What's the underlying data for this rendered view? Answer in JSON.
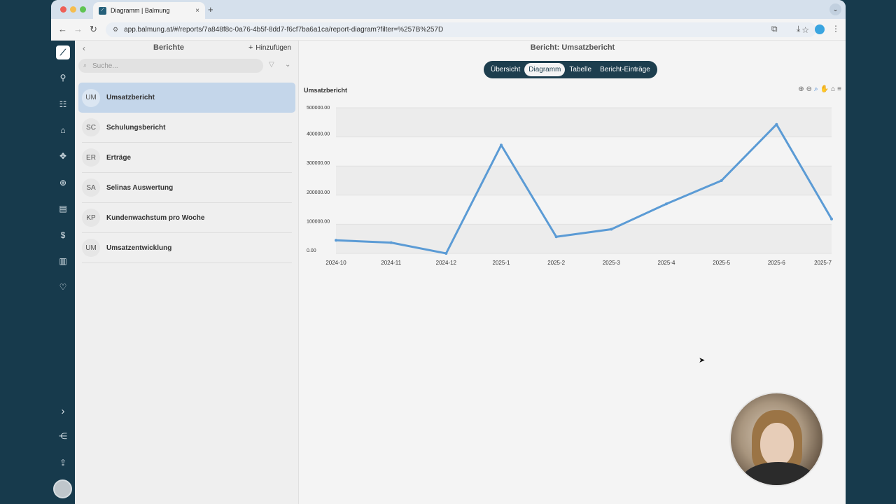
{
  "browser": {
    "tab_title": "Diagramm | Balmung",
    "tab_close": "×",
    "new_tab": "+",
    "url": "app.balmung.at/#/reports/7a848f8c-0a76-4b5f-8dd7-f6cf7ba6a1ca/report-diagram?filter=%257B%257D"
  },
  "panel": {
    "title": "Berichte",
    "add_label": "Hinzufügen",
    "search_placeholder": "Suche...",
    "reports": [
      {
        "abbr": "UM",
        "name": "Umsatzbericht"
      },
      {
        "abbr": "SC",
        "name": "Schulungsbericht"
      },
      {
        "abbr": "ER",
        "name": "Erträge"
      },
      {
        "abbr": "SA",
        "name": "Selinas Auswertung"
      },
      {
        "abbr": "KP",
        "name": "Kundenwachstum pro Woche"
      },
      {
        "abbr": "UM",
        "name": "Umsatzentwicklung"
      }
    ]
  },
  "main": {
    "title": "Bericht: Umsatzbericht",
    "tabs": [
      {
        "label": "Übersicht"
      },
      {
        "label": "Diagramm"
      },
      {
        "label": "Tabelle"
      },
      {
        "label": "Bericht-Einträge"
      }
    ],
    "active_tab": "Diagramm"
  },
  "colors": {
    "line": "#5b9bd5",
    "nav_bg": "#173a4c",
    "accent_selected": "#c4d6ea"
  },
  "chart_data": {
    "type": "line",
    "title": "Umsatzbericht",
    "xlabel": "",
    "ylabel": "",
    "x": [
      "2024-10",
      "2024-11",
      "2024-12",
      "2025-1",
      "2025-2",
      "2025-3",
      "2025-4",
      "2025-5",
      "2025-6",
      "2025-7"
    ],
    "series": [
      {
        "values": [
          45000,
          37000,
          0,
          372000,
          57000,
          83000,
          170000,
          250000,
          443000,
          118000
        ]
      }
    ],
    "yticks": [
      "0.00",
      "100000.00",
      "200000.00",
      "300000.00",
      "400000.00",
      "500000.00"
    ],
    "ylim": [
      0,
      500000
    ],
    "grid": true,
    "legend": "none"
  }
}
